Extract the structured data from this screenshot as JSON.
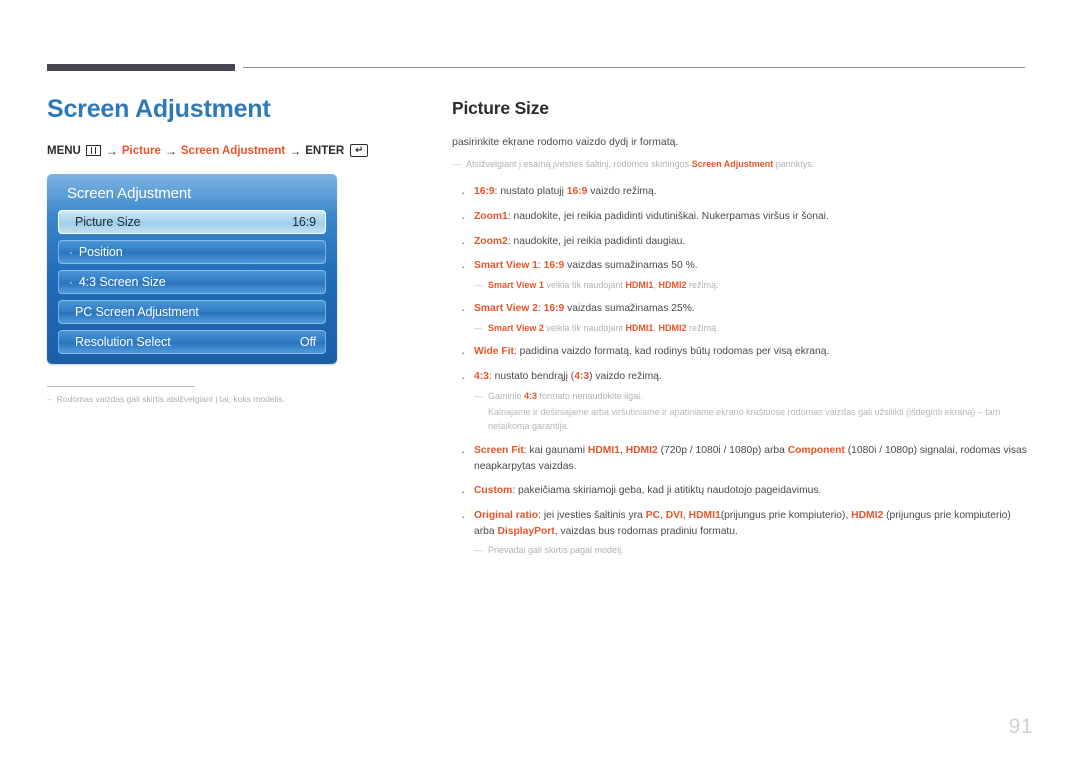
{
  "header": {
    "section_title": "Screen Adjustment"
  },
  "menu_path": {
    "menu_label": "MENU",
    "menu_icon": "menu-grid-icon",
    "arrow": "→",
    "crumb1": "Picture",
    "crumb2": "Screen Adjustment",
    "enter_label": "ENTER",
    "enter_icon": "enter-key-icon"
  },
  "osd": {
    "title": "Screen Adjustment",
    "rows": [
      {
        "label": "Picture Size",
        "value": "16:9",
        "selected": true,
        "dot": ""
      },
      {
        "label": "Position",
        "value": "",
        "selected": false,
        "dot": "·"
      },
      {
        "label": "4:3 Screen Size",
        "value": "",
        "selected": false,
        "dot": "·"
      },
      {
        "label": "PC Screen Adjustment",
        "value": "",
        "selected": false,
        "dot": ""
      },
      {
        "label": "Resolution Select",
        "value": "Off",
        "selected": false,
        "dot": ""
      }
    ]
  },
  "left_note": {
    "dash": "–",
    "text": "Rodomas vaizdas gali skirtis atsižvelgiant į tai, koks modelis."
  },
  "topic": {
    "title": "Picture Size",
    "intro": "pasirinkite ekrane rodomo vaizdo dydį ir formatą.",
    "intro_note": {
      "dash": "—",
      "pre": "Atsižvelgiant į esamą įvesties šaltinį, rodomos skirtingos ",
      "term": "Screen Adjustment",
      "post": " parinktys."
    }
  },
  "bullets": [
    {
      "term": "16:9",
      "rest_pre": ": nustato platujį ",
      "inline_term": "16:9",
      "rest_post": " vaizdo režimą."
    },
    {
      "term": "Zoom1",
      "rest_pre": ": naudokite, jei reikia padidinti vidutiniškai. Nukerpamas viršus ir šonai.",
      "inline_term": "",
      "rest_post": ""
    },
    {
      "term": "Zoom2",
      "rest_pre": ": naudokite, jei reikia padidinti daugiau.",
      "inline_term": "",
      "rest_post": ""
    },
    {
      "term": "Smart View 1",
      "rest_pre": ": ",
      "inline_term": "16:9",
      "rest_post": " vaizdas sumažinamas 50 %.",
      "note": {
        "dash": "—",
        "term1": "Smart View 1",
        "mid1": " veikia tik naudojant ",
        "term2": "HDMI1",
        "mid2": ", ",
        "term3": "HDMI2",
        "tail": " režimą."
      }
    },
    {
      "term": "Smart View 2",
      "rest_pre": ": ",
      "inline_term": "16:9",
      "rest_post": " vaizdas sumažinamas 25%.",
      "note": {
        "dash": "—",
        "term1": "Smart View 2",
        "mid1": " veikia tik naudojant ",
        "term2": "HDMI1",
        "mid2": ", ",
        "term3": "HDMI2",
        "tail": " režimą."
      }
    },
    {
      "term": "Wide Fit",
      "rest_pre": ": padidina vaizdo formatą, kad rodinys būtų rodomas per visą ekraną.",
      "inline_term": "",
      "rest_post": ""
    }
  ],
  "bullet_43": {
    "term": "4:3",
    "mid1": ": nustato bendrąjį (",
    "inline_term": "4:3",
    "mid2": ") vaizdo režimą.",
    "note": {
      "dash": "—",
      "pre": "Gaminio ",
      "term": "4:3",
      "post": " formato nenaudokite ilgai.",
      "extra": "Kairiajame ir dešiniajame arba viršutiniame ir apatiniame ekrano kraštuose rodomas vaizdas gali užsilikti (išdeginti ekraną) – tam netaikoma garantija."
    }
  },
  "bullet_screenfit": {
    "term": "Screen Fit",
    "p1": ": kai gaunami ",
    "t2": "HDMI1",
    "p2": ", ",
    "t3": "HDMI2",
    "p3": " (720p / 1080i / 1080p) arba ",
    "t4": "Component",
    "p4": " (1080i / 1080p) signalai, rodomas visas neapkarpytas vaizdas."
  },
  "bullet_custom": {
    "term": "Custom",
    "rest": ": pakeičiama skiriamoji geba, kad ji atitiktų naudotojo pageidavimus."
  },
  "bullet_original": {
    "term": "Original ratio",
    "p1": ": jei įvesties šaltinis yra ",
    "t2": "PC",
    "p2": ", ",
    "t3": "DVI",
    "p3": ", ",
    "t4": "HDMI1",
    "p4": "(prijungus prie kompiuterio), ",
    "t5": "HDMI2",
    "p5": " (prijungus prie kompiuterio) arba ",
    "t6": "DisplayPort",
    "p6": ", vaizdas bus rodomas pradiniu formatu.",
    "note": {
      "dash": "—",
      "text": "Prievadai gali skirtis pagal modelį."
    }
  },
  "footer": {
    "page_number": "91"
  },
  "colors": {
    "accent_blue": "#2e7ab8",
    "accent_orange": "#e8552a",
    "rule_dark": "#474755",
    "osd_blue": "#1f6cb8",
    "muted_gray": "#b2b2b6"
  }
}
